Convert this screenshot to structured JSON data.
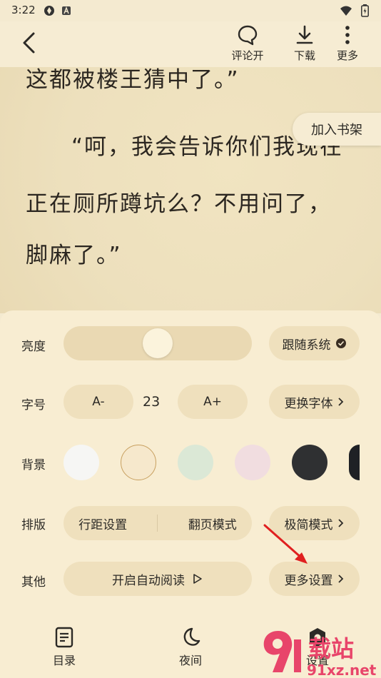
{
  "status": {
    "time": "3:22"
  },
  "topbar": {
    "comment_label": "评论开",
    "download_label": "下载",
    "more_label": "更多"
  },
  "content": {
    "lines": [
      "这都被楼王猜中了。”",
      "“呵，我会告诉你们我现在",
      "正在厕所蹲坑么？不用问了，",
      "脚麻了。”"
    ],
    "add_shelf": "加入书架"
  },
  "settings": {
    "brightness_label": "亮度",
    "brightness_level": 0.5,
    "follow_system": "跟随系统",
    "font_size_label": "字号",
    "font_decrease": "A-",
    "font_size_value": "23",
    "font_increase": "A+",
    "change_font": "更换字体",
    "background_label": "背景",
    "backgrounds": [
      "#f6f6f4",
      "#f6e8cc",
      "#dbe8d6",
      "#f1dde0",
      "#2f3032",
      "#1f2125"
    ],
    "layout_label": "排版",
    "line_spacing": "行距设置",
    "page_mode": "翻页模式",
    "simple_mode": "极简模式",
    "other_label": "其他",
    "auto_read": "开启自动阅读",
    "more_settings": "更多设置"
  },
  "bottom_nav": {
    "toc": "目录",
    "night": "夜间",
    "settings": "设置"
  },
  "watermark": {
    "text": "载站",
    "domain": "91xz.net"
  },
  "colors": {
    "accent": "#c8a060",
    "panel": "#f8edd2",
    "pill": "#efe0bd",
    "arrow": "#e02020"
  }
}
